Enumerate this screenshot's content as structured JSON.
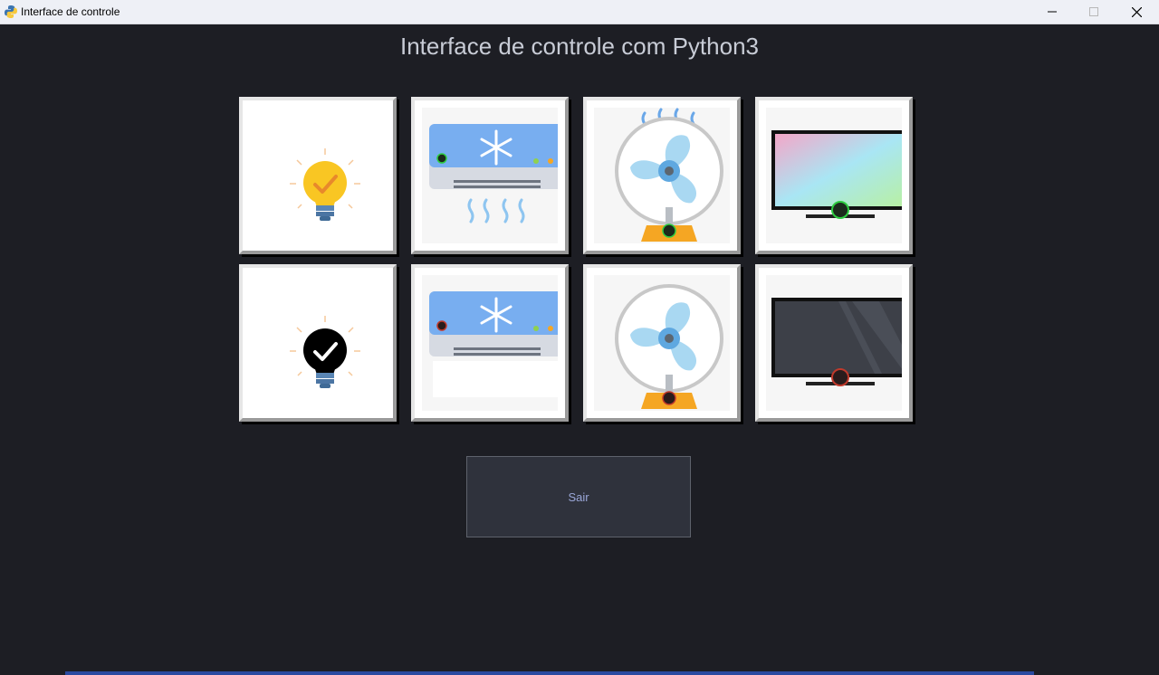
{
  "window": {
    "title": "Interface de controle",
    "icon": "python-icon",
    "controls": [
      "minimize-icon",
      "maximize-icon",
      "close-icon"
    ]
  },
  "main": {
    "title": "Interface de controle com Python3"
  },
  "devices": {
    "row_on": [
      {
        "device": "lamp",
        "state": "on",
        "icon": "lightbulb-on-icon"
      },
      {
        "device": "air-conditioner",
        "state": "on",
        "icon": "air-conditioner-on-icon"
      },
      {
        "device": "fan",
        "state": "on",
        "icon": "fan-on-icon"
      },
      {
        "device": "tv",
        "state": "on",
        "icon": "tv-on-icon"
      }
    ],
    "row_off": [
      {
        "device": "lamp",
        "state": "off",
        "icon": "lightbulb-off-icon"
      },
      {
        "device": "air-conditioner",
        "state": "off",
        "icon": "air-conditioner-off-icon"
      },
      {
        "device": "fan",
        "state": "off",
        "icon": "fan-off-icon"
      },
      {
        "device": "tv",
        "state": "off",
        "icon": "tv-off-icon"
      }
    ]
  },
  "colors": {
    "background": "#1d1e24",
    "power_on": "#2ecc40",
    "power_off": "#c0392b",
    "bulb_on": "#f9c623"
  },
  "exit_button": {
    "label": "Sair"
  }
}
